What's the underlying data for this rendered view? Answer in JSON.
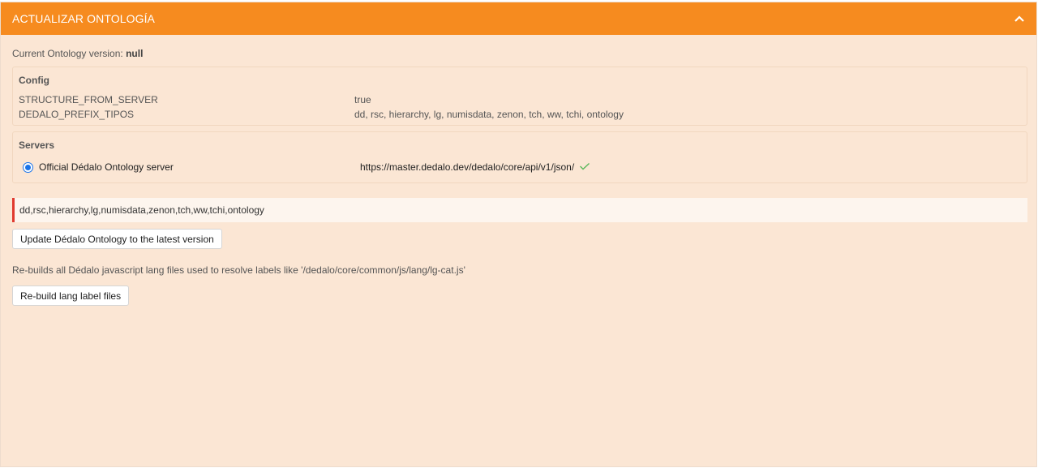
{
  "header": {
    "title": "ACTUALIZAR ONTOLOGÍA",
    "collapse_icon": "chevron-up-icon"
  },
  "version": {
    "label": "Current Ontology version:",
    "value": "null"
  },
  "config": {
    "title": "Config",
    "rows": [
      {
        "key": "STRUCTURE_FROM_SERVER",
        "value": "true"
      },
      {
        "key": "DEDALO_PREFIX_TIPOS",
        "value": "dd, rsc, hierarchy, lg, numisdata, zenon, tch, ww, tchi, ontology"
      }
    ]
  },
  "servers": {
    "title": "Servers",
    "items": [
      {
        "label": "Official Dédalo Ontology server",
        "url": "https://master.dedalo.dev/dedalo/core/api/v1/json/",
        "selected": true,
        "status_icon": "check-icon"
      }
    ]
  },
  "tipos_input": {
    "value": "dd,rsc,hierarchy,lg,numisdata,zenon,tch,ww,tchi,ontology"
  },
  "update_button": {
    "label": "Update Dédalo Ontology to the latest version"
  },
  "rebuild": {
    "description": "Re-builds all Dédalo javascript lang files used to resolve labels like '/dedalo/core/common/js/lang/lg-cat.js'",
    "button_label": "Re-build lang label files"
  },
  "colors": {
    "header_bg": "#f68b1f",
    "panel_bg": "#fbe6d4",
    "error_border": "#e03a2f",
    "radio": "#1a73e8",
    "check": "#5cb85c"
  }
}
